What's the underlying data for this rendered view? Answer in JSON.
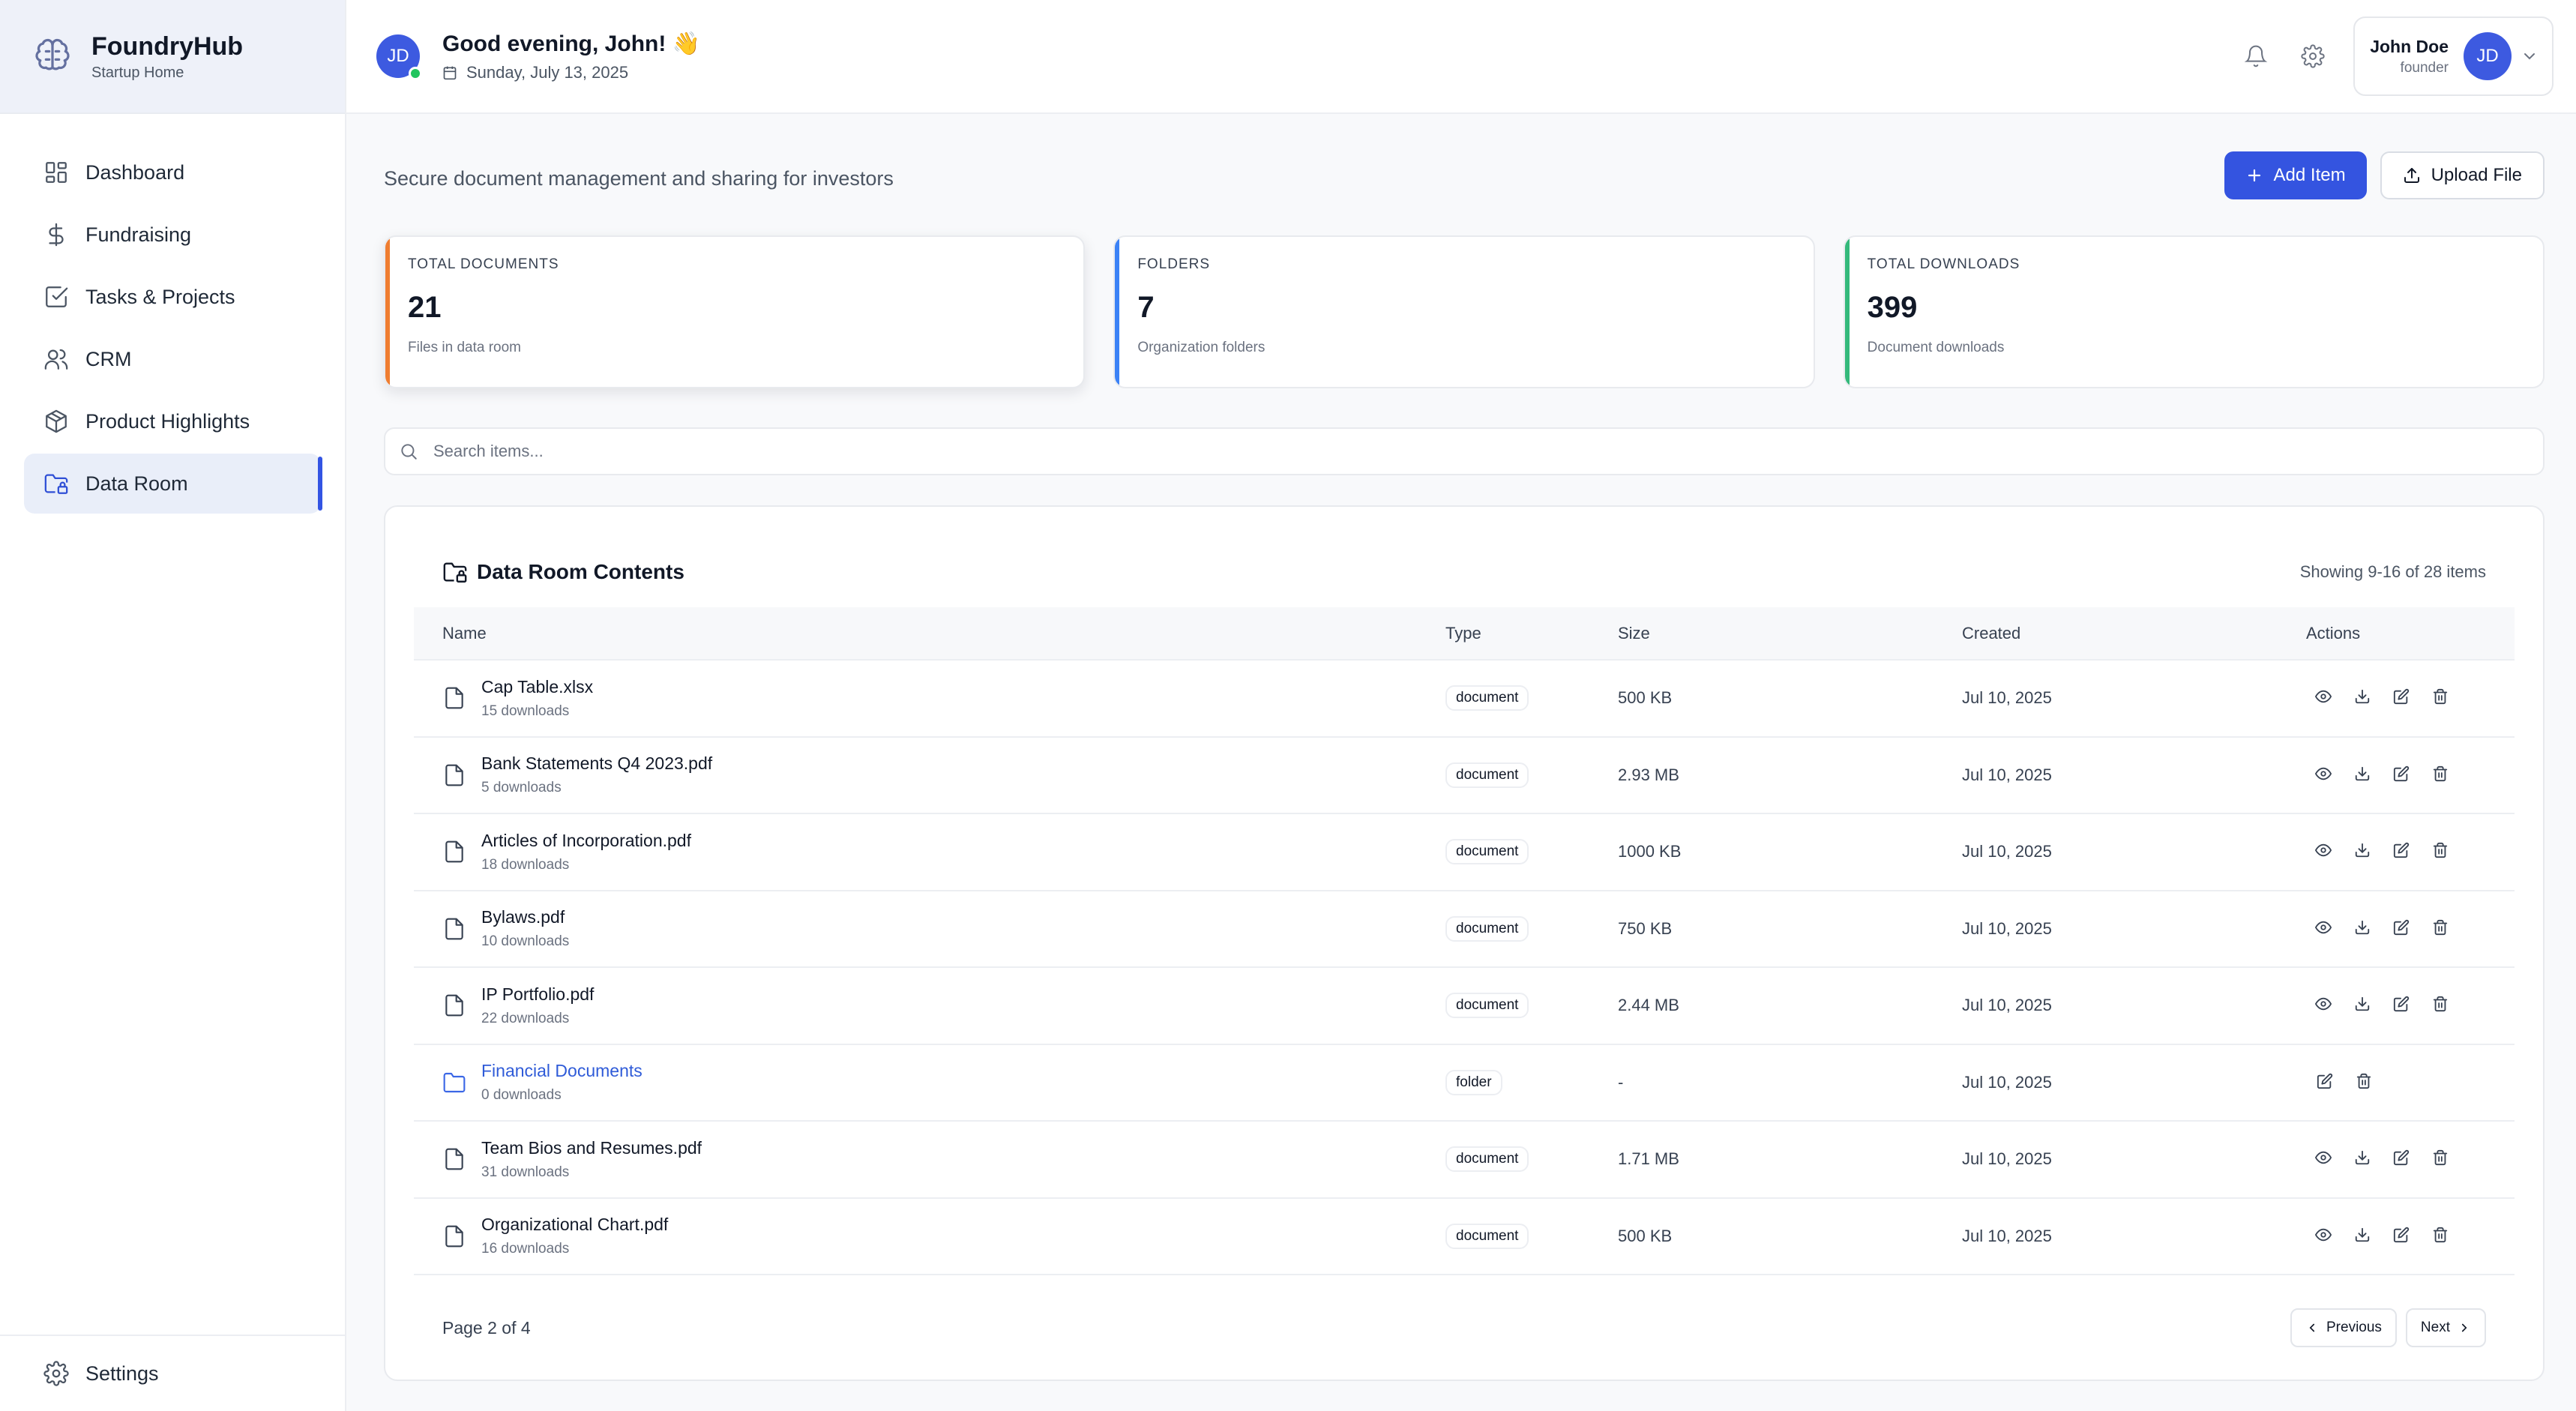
{
  "brand": {
    "name": "FoundryHub",
    "subtitle": "Startup Home",
    "logo_icon": "brain-icon"
  },
  "sidebar": {
    "items": [
      {
        "label": "Dashboard",
        "icon": "dashboard-icon",
        "active": false
      },
      {
        "label": "Fundraising",
        "icon": "dollar-icon",
        "active": false
      },
      {
        "label": "Tasks & Projects",
        "icon": "checkbox-icon",
        "active": false
      },
      {
        "label": "CRM",
        "icon": "users-icon",
        "active": false
      },
      {
        "label": "Product Highlights",
        "icon": "package-icon",
        "active": false
      },
      {
        "label": "Data Room",
        "icon": "folder-lock-icon",
        "active": true
      }
    ],
    "footer": {
      "label": "Settings",
      "icon": "gear-icon"
    }
  },
  "topbar": {
    "avatar_initials": "JD",
    "greeting": "Good evening, John! 👋",
    "date": "Sunday, July 13, 2025",
    "user": {
      "name": "John Doe",
      "role": "founder",
      "initials": "JD"
    }
  },
  "page": {
    "subtitle": "Secure document management and sharing for investors",
    "add_button": "Add Item",
    "upload_button": "Upload File"
  },
  "stats": [
    {
      "label": "TOTAL DOCUMENTS",
      "value": "21",
      "sub": "Files in data room",
      "accent": "#ef7d30"
    },
    {
      "label": "FOLDERS",
      "value": "7",
      "sub": "Organization folders",
      "accent": "#3b82f6"
    },
    {
      "label": "TOTAL DOWNLOADS",
      "value": "399",
      "sub": "Document downloads",
      "accent": "#34b97b"
    }
  ],
  "search": {
    "placeholder": "Search items..."
  },
  "table": {
    "title": "Data Room Contents",
    "showing": "Showing 9-16 of 28 items",
    "columns": [
      "Name",
      "Type",
      "Size",
      "Created",
      "Actions"
    ],
    "rows": [
      {
        "name": "Cap Table.xlsx",
        "downloads": "15 downloads",
        "type": "document",
        "size": "500 KB",
        "created": "Jul 10, 2025"
      },
      {
        "name": "Bank Statements Q4 2023.pdf",
        "downloads": "5 downloads",
        "type": "document",
        "size": "2.93 MB",
        "created": "Jul 10, 2025"
      },
      {
        "name": "Articles of Incorporation.pdf",
        "downloads": "18 downloads",
        "type": "document",
        "size": "1000 KB",
        "created": "Jul 10, 2025"
      },
      {
        "name": "Bylaws.pdf",
        "downloads": "10 downloads",
        "type": "document",
        "size": "750 KB",
        "created": "Jul 10, 2025"
      },
      {
        "name": "IP Portfolio.pdf",
        "downloads": "22 downloads",
        "type": "document",
        "size": "2.44 MB",
        "created": "Jul 10, 2025"
      },
      {
        "name": "Financial Documents",
        "downloads": "0 downloads",
        "type": "folder",
        "size": "-",
        "created": "Jul 10, 2025"
      },
      {
        "name": "Team Bios and Resumes.pdf",
        "downloads": "31 downloads",
        "type": "document",
        "size": "1.71 MB",
        "created": "Jul 10, 2025"
      },
      {
        "name": "Organizational Chart.pdf",
        "downloads": "16 downloads",
        "type": "document",
        "size": "500 KB",
        "created": "Jul 10, 2025"
      }
    ],
    "pagination": {
      "info": "Page 2 of 4",
      "prev": "Previous",
      "next": "Next"
    }
  },
  "colors": {
    "accent": "#3454e0",
    "folder_link": "#2f5bd8",
    "online": "#22c55e"
  }
}
